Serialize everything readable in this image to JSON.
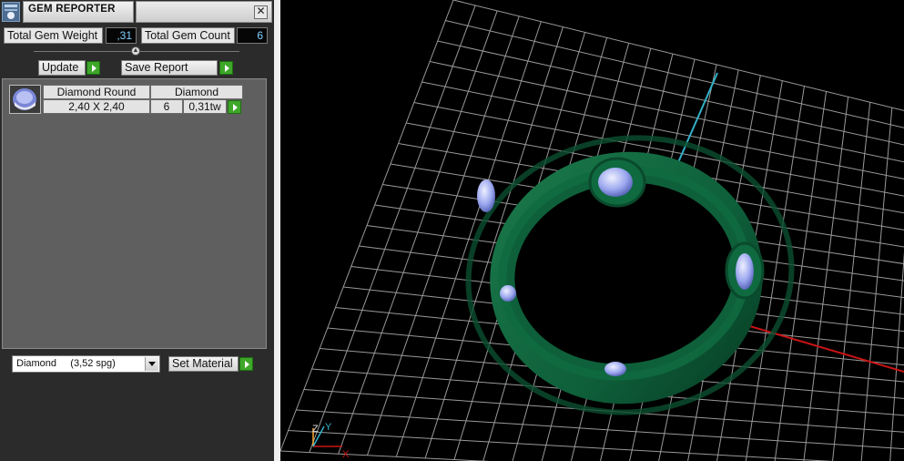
{
  "window": {
    "title": "GEM REPORTER",
    "close_glyph": "✕"
  },
  "summary": {
    "weight_label": "Total Gem Weight",
    "weight_value": ",31",
    "count_label": "Total Gem Count",
    "count_value": "6"
  },
  "toolbar": {
    "update_label": "Update",
    "save_label": "Save Report"
  },
  "gems": [
    {
      "name": "Diamond Round",
      "material": "Diamond",
      "size": "2,40 X 2,40",
      "count": "6",
      "weight": "0,31tw"
    }
  ],
  "material_picker": {
    "selected": "Diamond     (3,52 spg)",
    "set_label": "Set Material"
  },
  "viewport": {
    "axis_labels": {
      "x": "X",
      "y": "Y",
      "z": "Z"
    },
    "colors": {
      "ring": "#0e5f3a",
      "grid": "#b4b4b4",
      "axis_x": "#c81414",
      "axis_y": "#33b0c8",
      "gem": "#9aa6ee"
    }
  },
  "icons": [
    "gem-reporter-app-icon",
    "close-icon",
    "expand-collapse-icon",
    "play-arrow-icon",
    "dropdown-arrow-icon",
    "diamond-gem-icon"
  ]
}
